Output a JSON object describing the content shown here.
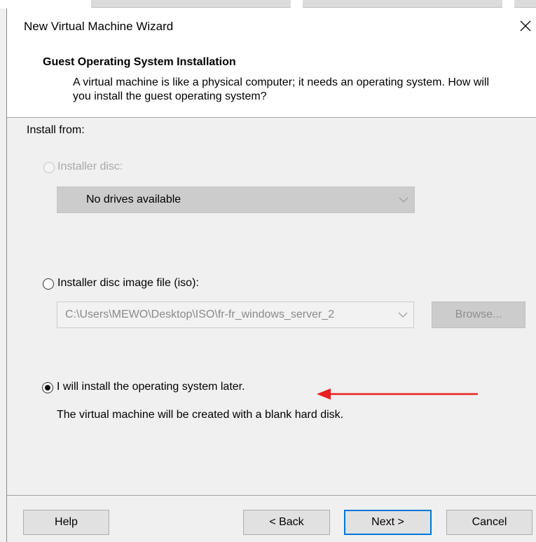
{
  "window": {
    "title": "New Virtual Machine Wizard",
    "close_icon": "close-icon"
  },
  "header": {
    "title": "Guest Operating System Installation",
    "description": "A virtual machine is like a physical computer; it needs an operating system. How will you install the guest operating system?"
  },
  "install_from": {
    "label": "Install from:",
    "options": [
      {
        "label": "Installer disc:",
        "selected": false,
        "enabled": false,
        "dropdown_value": "No drives available"
      },
      {
        "label": "Installer disc image file (iso):",
        "selected": false,
        "enabled": true,
        "path_value": "C:\\Users\\MEWO\\Desktop\\ISO\\fr-fr_windows_server_2",
        "browse_label": "Browse..."
      },
      {
        "label": "I will install the operating system later.",
        "selected": true,
        "enabled": true,
        "description": "The virtual machine will be created with a blank hard disk."
      }
    ]
  },
  "annotation": {
    "arrow_color": "#e8201f",
    "icon": "red-arrow-icon"
  },
  "footer": {
    "help_label": "Help",
    "back_label": "< Back",
    "next_label": "Next >",
    "cancel_label": "Cancel"
  },
  "colors": {
    "accent": "#0078d7",
    "disabled_text": "#a8a8a8"
  }
}
